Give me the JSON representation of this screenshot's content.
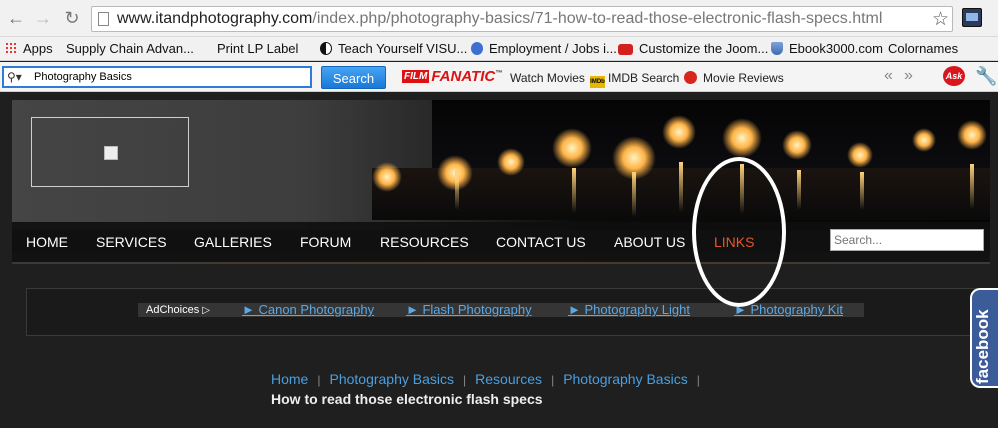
{
  "browser": {
    "url_host": "www.itandphotography.com",
    "url_path": "/index.php/photography-basics/71-how-to-read-those-electronic-flash-specs.html",
    "back_icon": "back-arrow-icon",
    "forward_icon": "forward-arrow-icon",
    "reload_icon": "reload-icon",
    "star_icon": "bookmark-star-icon"
  },
  "bookmarks": [
    {
      "label": "Apps",
      "icon": "apps-grid-icon"
    },
    {
      "label": "Supply Chain Advan...",
      "icon": "page-icon"
    },
    {
      "label": "Print LP Label",
      "icon": "page-icon"
    },
    {
      "label": "Teach Yourself VISU...",
      "icon": "yinyang-icon"
    },
    {
      "label": "Employment / Jobs i...",
      "icon": "globe-icon"
    },
    {
      "label": "Customize the Joom...",
      "icon": "youtube-icon"
    },
    {
      "label": "Ebook3000.com",
      "icon": "shield-icon"
    },
    {
      "label": "Colornames",
      "icon": "page-icon"
    }
  ],
  "toolbar": {
    "search_value": "Photography Basics",
    "search_button": "Search",
    "film_badge": "FILM",
    "fanatic_logo": "FANATIC",
    "tm": "™",
    "watch_movies": "Watch Movies",
    "imdb_badge": "IMDb",
    "imdb_search": "IMDB Search",
    "movie_reviews": "Movie Reviews",
    "ask_logo": "Ask"
  },
  "site": {
    "nav": [
      {
        "label": "HOME",
        "active": false
      },
      {
        "label": "SERVICES",
        "active": false
      },
      {
        "label": "GALLERIES",
        "active": false
      },
      {
        "label": "FORUM",
        "active": false
      },
      {
        "label": "RESOURCES",
        "active": false
      },
      {
        "label": "CONTACT US",
        "active": false
      },
      {
        "label": "ABOUT US",
        "active": false
      },
      {
        "label": "LINKS",
        "active": true
      }
    ],
    "search_placeholder": "Search...",
    "active_color": "#e8562a",
    "link_color": "#4a9fe0"
  },
  "ads": {
    "adchoices": "AdChoices",
    "links": [
      "► Canon Photography",
      "► Flash Photography",
      "► Photography Light",
      "► Photography Kit"
    ]
  },
  "breadcrumb": {
    "items": [
      "Home",
      "Photography Basics",
      "Resources",
      "Photography Basics"
    ],
    "separator": "|",
    "current": "How to read those electronic flash specs"
  },
  "facebook_tab": "facebook"
}
